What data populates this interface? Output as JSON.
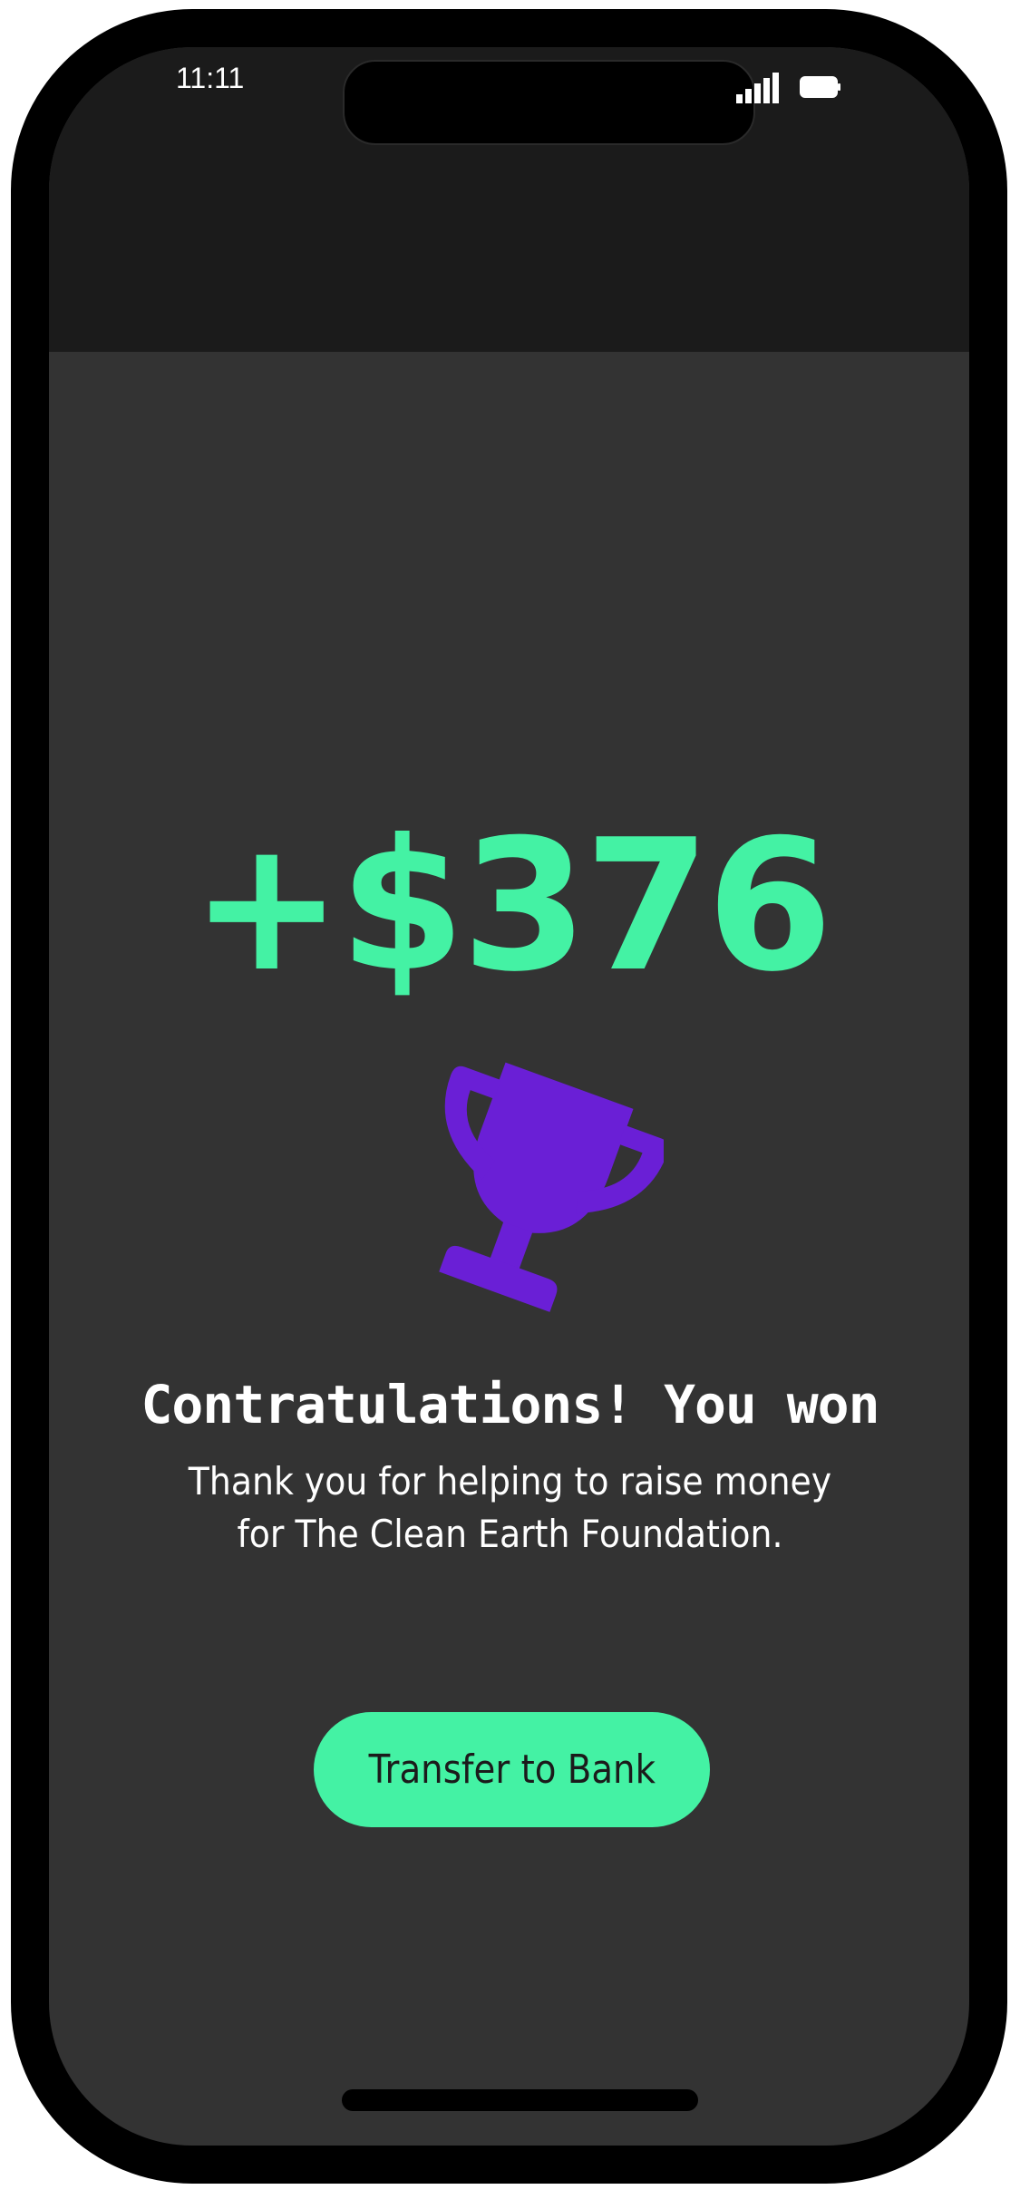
{
  "status_bar": {
    "time": "11:11",
    "signal_icon": "cellular-signal-icon",
    "battery_icon": "battery-icon"
  },
  "reward": {
    "amount": "+$376",
    "icon": "trophy-icon",
    "title": "Contratulations! You won",
    "message": "Thank you for helping to raise money for The Clean Earth Foundation."
  },
  "actions": {
    "transfer_label": "Transfer to Bank"
  },
  "colors": {
    "accent": "#44f2a4",
    "trophy": "#6a1fd6",
    "background": "#333333",
    "header": "#1b1b1b"
  }
}
